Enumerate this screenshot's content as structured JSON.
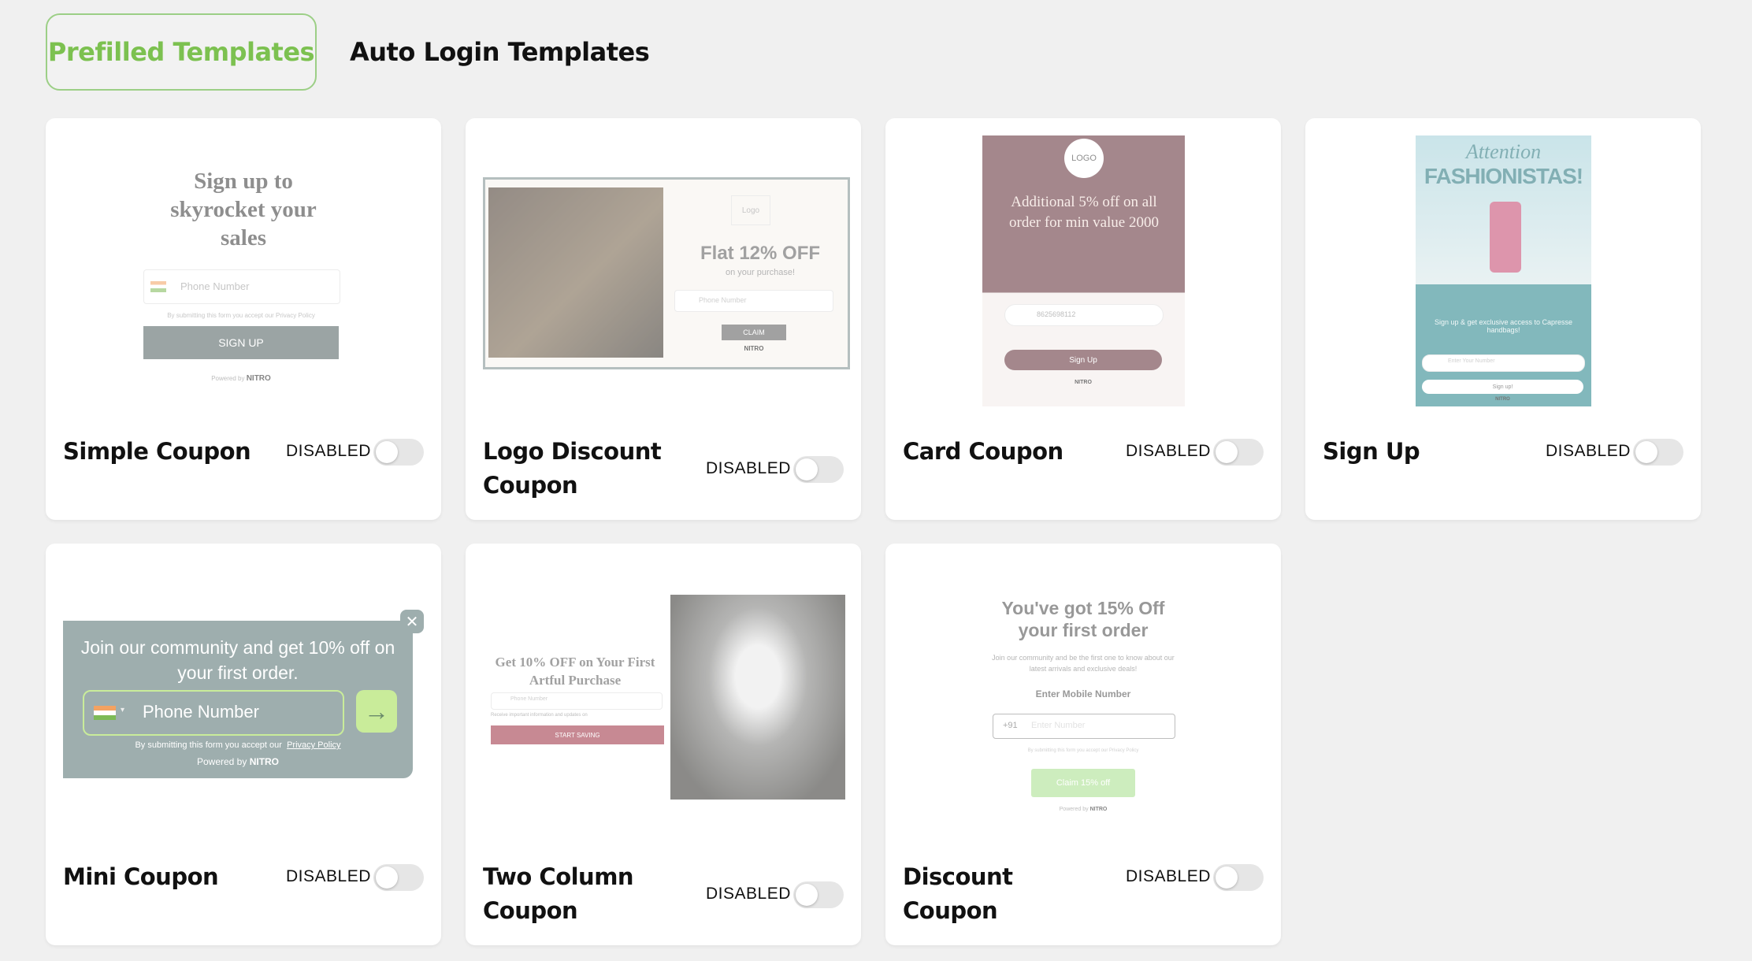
{
  "tabs": {
    "prefilled": "Prefilled Templates",
    "auto_login": "Auto Login Templates"
  },
  "cards": [
    {
      "title": "Simple Coupon",
      "status": "DISABLED",
      "preview": {
        "headline": "Sign up to skyrocket your sales",
        "field": "Phone Number",
        "consent": "By submitting this form you accept our Privacy Policy",
        "button": "SIGN UP",
        "powered": "Powered by",
        "brand": "NITRO"
      }
    },
    {
      "title": "Logo Discount Coupon",
      "status": "DISABLED",
      "preview": {
        "logo": "Logo",
        "headline": "Flat 12% OFF",
        "sub": "on your purchase!",
        "field": "Phone Number",
        "button": "CLAIM",
        "brand": "NITRO"
      }
    },
    {
      "title": "Card Coupon",
      "status": "DISABLED",
      "preview": {
        "logo": "LOGO",
        "headline": "Additional 5% off on all order for min value 2000",
        "field": "8625698112",
        "button": "Sign Up",
        "brand": "NITRO"
      }
    },
    {
      "title": "Sign Up",
      "status": "DISABLED",
      "preview": {
        "script": "Attention",
        "headline": "FASHIONISTAS!",
        "sub": "Sign up & get exclusive access to Capresse handbags!",
        "field": "Enter Your Number",
        "button": "Sign up!",
        "brand": "NITRO"
      }
    },
    {
      "title": "Mini Coupon",
      "status": "DISABLED",
      "preview": {
        "headline": "Join our community and get 10% off on your first order.",
        "field": "Phone Number",
        "consent": "By submitting this form you accept our",
        "policy": "Privacy Policy",
        "powered": "Powered by",
        "brand": "NITRO"
      }
    },
    {
      "title": "Two Column Coupon",
      "status": "DISABLED",
      "preview": {
        "headline": "Get 10% OFF on Your First Artful Purchase",
        "field": "Phone Number",
        "checkbox": "Receive important information and updates on",
        "button": "START SAVING"
      }
    },
    {
      "title": "Discount Coupon",
      "status": "DISABLED",
      "preview": {
        "headline": "You've got 15% Off your first order",
        "sub": "Join our community and be the first one to know about our latest arrivals and exclusive deals!",
        "label": "Enter Mobile Number",
        "code": "+91",
        "placeholder": "Enter Number",
        "consent": "By submitting this form you accept our Privacy Policy",
        "button": "Claim 15% off",
        "powered": "Powered by",
        "brand": "NITRO"
      }
    }
  ]
}
